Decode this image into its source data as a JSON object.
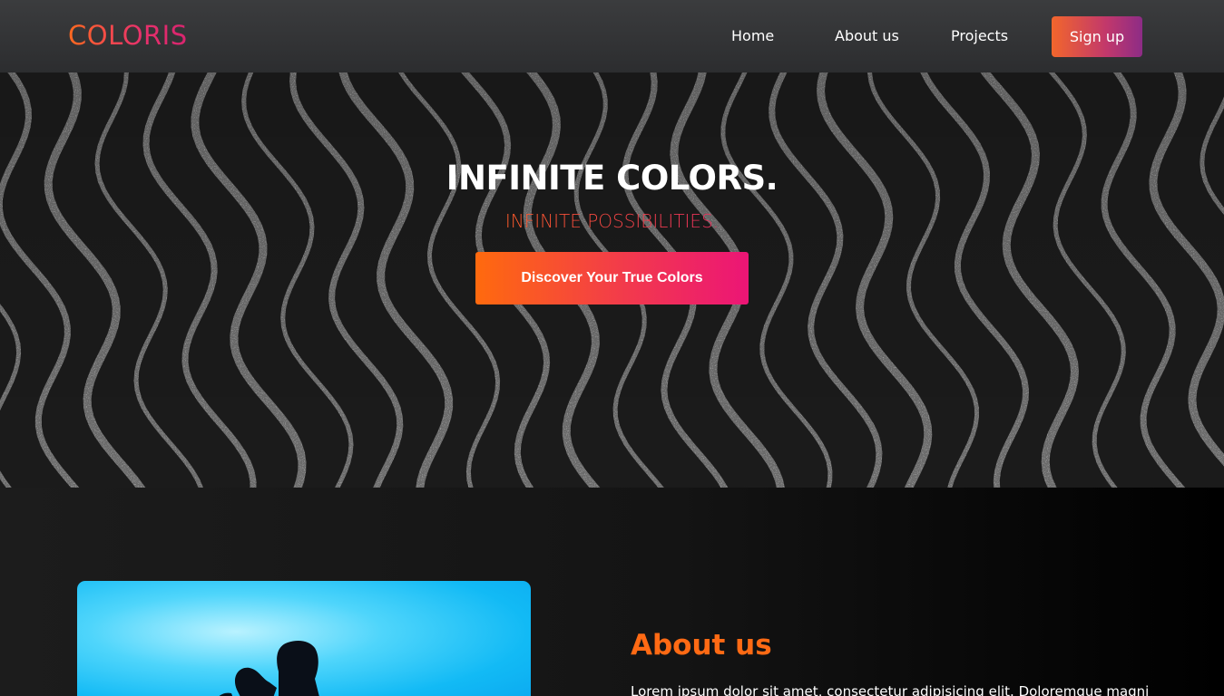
{
  "navbar": {
    "logo": "COLORIS",
    "links": [
      "Home",
      "About us",
      "Projects"
    ],
    "signup_label": "Sign up"
  },
  "hero": {
    "title": "INFINITE COLORS.",
    "subtitle": "INFINITE POSSIBILITIES.",
    "cta_label": "Discover Your True Colors"
  },
  "about": {
    "heading": "About us",
    "text": "Lorem ipsum dolor sit amet, consectetur adipisicing elit. Doloremque magni"
  },
  "colors": {
    "accent_orange": "#ff6a14",
    "accent_pink": "#ec1576",
    "nav_bg": "#333436",
    "image_blue": "#12baf5"
  }
}
